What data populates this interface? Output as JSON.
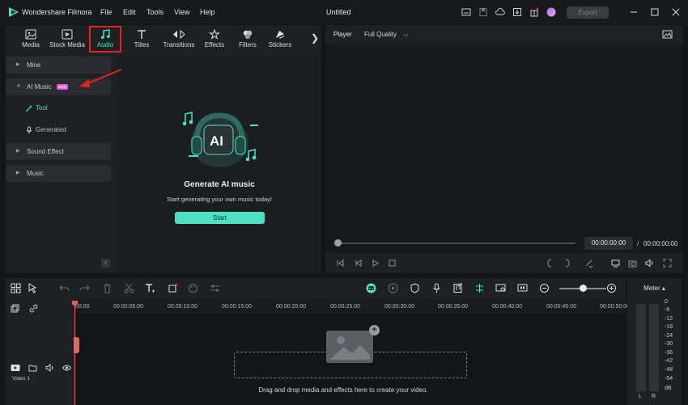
{
  "app": {
    "name": "Wondershare Filmora",
    "menu": [
      "File",
      "Edit",
      "Tools",
      "View",
      "Help"
    ],
    "doc_title": "Untitled",
    "export_label": "Export"
  },
  "media_tabs": [
    {
      "label": "Media",
      "icon": "media-icon"
    },
    {
      "label": "Stock Media",
      "icon": "stock-media-icon"
    },
    {
      "label": "Audio",
      "icon": "music-note-icon",
      "active": true
    },
    {
      "label": "Titles",
      "icon": "titles-icon"
    },
    {
      "label": "Transitions",
      "icon": "transitions-icon"
    },
    {
      "label": "Effects",
      "icon": "effects-icon"
    },
    {
      "label": "Filters",
      "icon": "filters-icon"
    },
    {
      "label": "Stickers",
      "icon": "stickers-icon"
    }
  ],
  "sidebar": {
    "mine": "Mine",
    "ai_music": "AI Music",
    "ai_music_badge": "NEW",
    "tool": "Tool",
    "generated": "Generated",
    "sound_effect": "Sound Effect",
    "music": "Music"
  },
  "generate": {
    "title": "Generate AI music",
    "subtitle": "Start generating your own music today!",
    "start_label": "Start",
    "art_text": "AI"
  },
  "player": {
    "label": "Player",
    "quality": "Full Quality",
    "current_time": "00:00:00:00",
    "separator": "/",
    "total_time": "00:00:00:00"
  },
  "timeline": {
    "ruler": [
      "00:00",
      "00:00:05:00",
      "00:00:10:00",
      "00:00:15:00",
      "00:00:20:00",
      "00:00:25:00",
      "00:00:30:00",
      "00:00:35:00",
      "00:00:40:00",
      "00:00:45:00",
      "00:00:50:00"
    ],
    "drop_text": "Drag and drop media and effects here to create your video.",
    "track_label": "Video 1",
    "zoom_level": 0.5
  },
  "meter": {
    "label": "Meter ▴",
    "scale": [
      "0",
      "-6",
      "-12",
      "-18",
      "-24",
      "-30",
      "-36",
      "-42",
      "-48",
      "-54"
    ],
    "unit": "dB",
    "left": "L",
    "right": "R"
  },
  "colors": {
    "accent": "#4fe0c3",
    "highlight_box": "#e8231f",
    "playhead": "#ef5a5a"
  }
}
